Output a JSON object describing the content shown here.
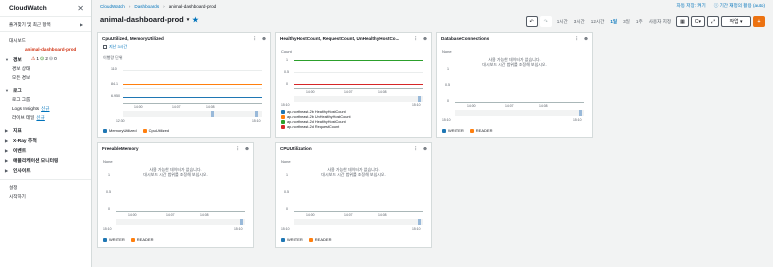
{
  "sidebar": {
    "title": "CloudWatch",
    "favorites": "즐겨찾기 및 최근 항목",
    "dashboards": "대시보드",
    "active_dashboard": "animal-dashboard-prod",
    "alarms": {
      "label": "경보",
      "in_alarm": "1",
      "ok": "2",
      "insufficient": "0"
    },
    "alarm_state": "경보 상태",
    "all_alarms": "모든 경보",
    "logs": "로그",
    "log_groups": "로그 그룹",
    "logs_insights": "Logs Insights",
    "logs_insights_badge": "신규",
    "live_tail": "라이브 테일",
    "live_tail_badge": "신규",
    "metrics": "지표",
    "xray": "X-Ray 추적",
    "events": "이벤트",
    "app_monitoring": "애플리케이션 모니터링",
    "insights": "인사이트",
    "settings": "설정",
    "getting_started": "시작하기"
  },
  "breadcrumb": {
    "root": "CloudWatch",
    "dashboards": "Dashboards",
    "current": "animal-dashboard-prod"
  },
  "header": {
    "title": "animal-dashboard-prod",
    "autosave": "자동 저장: 켜기",
    "period_override": "기간 재정의 활용 (auto)"
  },
  "toolbar": {
    "time_options": [
      "1시간",
      "3시간",
      "12시간",
      "1일",
      "3일",
      "1주",
      "사용자 지정"
    ],
    "active_time": "1일",
    "refresh_label": "C",
    "actions_label": "작업",
    "add_label": "+",
    "undo": "↶",
    "redo": "↷"
  },
  "widgets": [
    {
      "title": "CpuUtilized, MemoryUtilized",
      "range_label": "지난 3시간",
      "unit": "이행량 단위",
      "yticks": [
        "110",
        "84.1",
        "6.950"
      ],
      "xticks": [
        "12:30",
        "14:00",
        "14:07",
        "14:08",
        "15:10"
      ],
      "legend": [
        {
          "name": "MemoryUtilized",
          "color": "#1f77b4"
        },
        {
          "name": "CpuUtilized",
          "color": "#ff7f0e"
        }
      ]
    },
    {
      "title": "HealthyHostCount, RequestCount, UnHealthyHostCo...",
      "unit": "Count",
      "yticks": [
        "1",
        "0.5",
        "0"
      ],
      "xticks": [
        "15:10",
        "14:00",
        "14:07",
        "14:08",
        "15:10"
      ],
      "legend": [
        {
          "name": "ap-northeast-2b HealthyHostCount",
          "color": "#1f77b4"
        },
        {
          "name": "ap-northeast-2b UnHealthyHostCount",
          "color": "#ff7f0e"
        },
        {
          "name": "ap-northeast-2d HealthyHostCount",
          "color": "#2ca02c"
        },
        {
          "name": "ap-northeast-2d RequestCount",
          "color": "#d62728"
        }
      ]
    },
    {
      "title": "DatabaseConnections",
      "unit": "None",
      "no_data_1": "사용 가능한 데이터가 없습니다.",
      "no_data_2": "대시보드 시간 범위를 조정해 보십시오.",
      "yticks": [
        "1",
        "0.5",
        "0"
      ],
      "xticks": [
        "15:10",
        "14:00",
        "14:07",
        "14:08",
        "15:10"
      ],
      "legend": [
        {
          "name": "WRITER",
          "color": "#1f77b4"
        },
        {
          "name": "READER",
          "color": "#ff7f0e"
        }
      ]
    },
    {
      "title": "FreeableMemory",
      "unit": "None",
      "no_data_1": "사용 가능한 데이터가 없습니다.",
      "no_data_2": "대시보드 시간 범위를 조정해 보십시오.",
      "yticks": [
        "1",
        "0.5",
        "0"
      ],
      "xticks": [
        "15:10",
        "14:00",
        "14:07",
        "14:08",
        "15:10"
      ],
      "legend": [
        {
          "name": "WRITER",
          "color": "#1f77b4"
        },
        {
          "name": "READER",
          "color": "#ff7f0e"
        }
      ]
    },
    {
      "title": "CPUUtilization",
      "unit": "None",
      "no_data_1": "사용 가능한 데이터가 없습니다.",
      "no_data_2": "대시보드 시간 범위를 조정해 보십시오.",
      "yticks": [
        "1",
        "0.5",
        "0"
      ],
      "xticks": [
        "15:10",
        "14:00",
        "14:07",
        "14:08",
        "15:10"
      ],
      "legend": [
        {
          "name": "WRITER",
          "color": "#1f77b4"
        },
        {
          "name": "READER",
          "color": "#ff7f0e"
        }
      ]
    }
  ],
  "widget_menu_icon": "⋮",
  "widget_zoom_icon": "🔍"
}
